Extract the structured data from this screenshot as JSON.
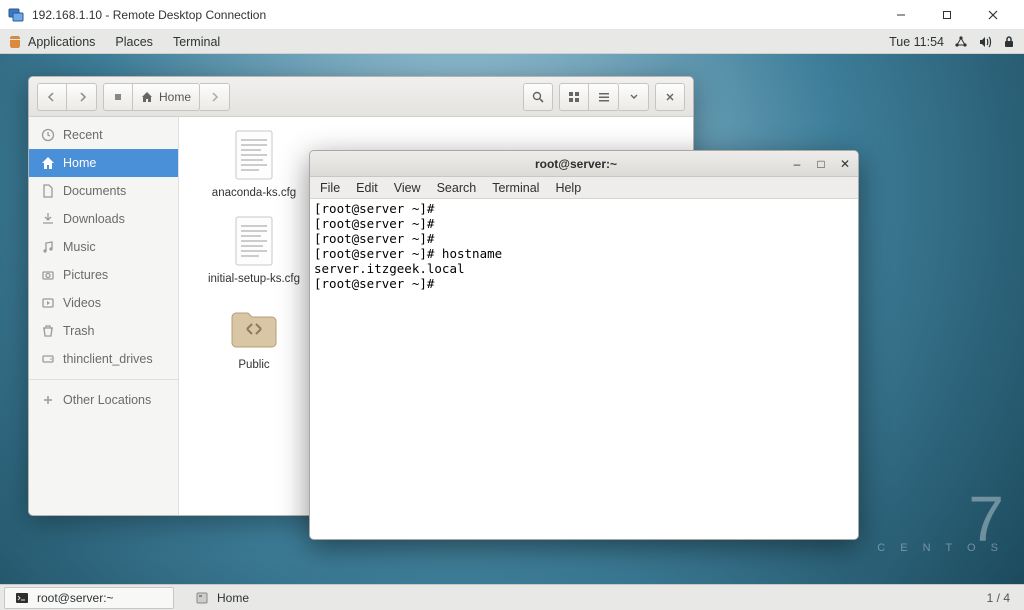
{
  "rdp": {
    "title": "192.168.1.10 - Remote Desktop Connection"
  },
  "gnome": {
    "menus": [
      "Applications",
      "Places",
      "Terminal"
    ],
    "clock": "Tue 11:54"
  },
  "centos": {
    "digit": "7",
    "label": "C E N T O S"
  },
  "files": {
    "breadcrumb": "Home",
    "sidebar": {
      "recent": "Recent",
      "home": "Home",
      "documents": "Documents",
      "downloads": "Downloads",
      "music": "Music",
      "pictures": "Pictures",
      "videos": "Videos",
      "trash": "Trash",
      "thinclient": "thinclient_drives",
      "other": "Other Locations"
    },
    "items": {
      "anaconda": "anaconda-ks.cfg",
      "initial": "initial-setup-ks.cfg",
      "public": "Public"
    }
  },
  "terminal": {
    "title": "root@server:~",
    "menus": [
      "File",
      "Edit",
      "View",
      "Search",
      "Terminal",
      "Help"
    ],
    "content": "[root@server ~]#\n[root@server ~]#\n[root@server ~]#\n[root@server ~]# hostname\nserver.itzgeek.local\n[root@server ~]#"
  },
  "taskbar": {
    "task1": "root@server:~",
    "task2": "Home",
    "workspace": "1 / 4"
  }
}
